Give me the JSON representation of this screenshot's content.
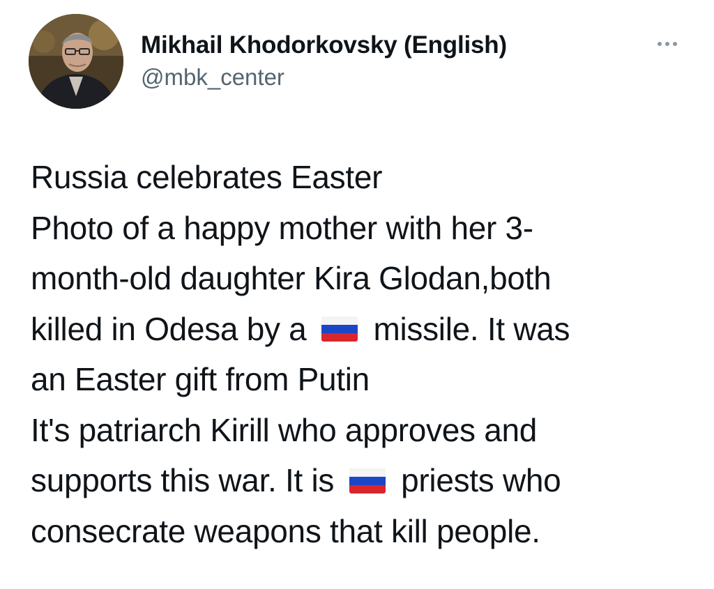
{
  "author": {
    "name": "Mikhail Khodorkovsky (English)",
    "handle": "@mbk_center",
    "avatar_icon": "profile-photo"
  },
  "menu": {
    "icon": "more-horizontal-icon"
  },
  "tweet": {
    "lines": [
      {
        "text": "Russia celebrates Easter"
      },
      {
        "text": "Photo of a happy mother with her 3-"
      },
      {
        "text": "month-old daughter Kira Glodan,both"
      },
      {
        "before": "killed in Odesa by a",
        "flag": "russian-flag",
        "after": "missile. It was"
      },
      {
        "text": "an Easter gift from Putin"
      },
      {
        "text": "It's patriarch Kirill who approves and"
      },
      {
        "before": "supports this war. It is",
        "flag": "russian-flag",
        "after": "priests who"
      },
      {
        "text": "consecrate weapons that kill people."
      }
    ]
  },
  "colors": {
    "text": "#0f1419",
    "secondary": "#536471",
    "flag_white": "#f4f4f4",
    "flag_blue": "#1a46c8",
    "flag_red": "#d8262b"
  }
}
